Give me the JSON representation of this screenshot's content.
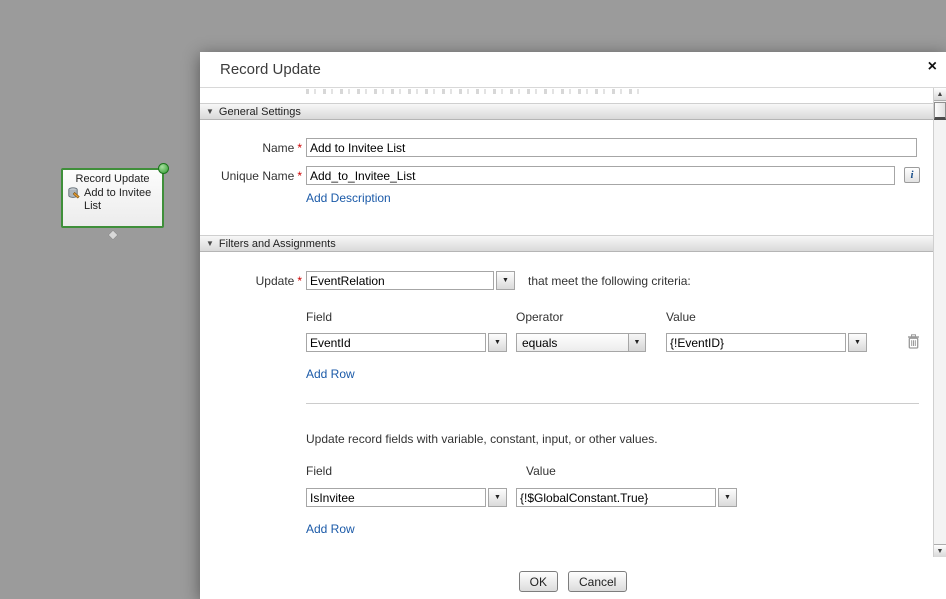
{
  "icons": {
    "collapse": "▼",
    "dropdown": "▼",
    "scroll_up": "▲",
    "scroll_down": "▼",
    "close": "×",
    "info": "i"
  },
  "canvas": {
    "node": {
      "title": "Record Update",
      "label": "Add to Invitee List"
    }
  },
  "dialog": {
    "title": "Record Update",
    "required_marker": "*",
    "general": {
      "header": "General Settings",
      "name_label": "Name",
      "name_value": "Add to Invitee List",
      "unique_name_label": "Unique Name",
      "unique_name_value": "Add_to_Invitee_List",
      "add_description": "Add Description"
    },
    "filters": {
      "header": "Filters and Assignments",
      "update_label": "Update",
      "update_value": "EventRelation",
      "criteria_text": "that meet the following criteria:",
      "col_field": "Field",
      "col_operator": "Operator",
      "col_value": "Value",
      "row": {
        "field": "EventId",
        "operator": "equals",
        "value": "{!EventID}"
      },
      "add_row": "Add Row"
    },
    "assignments": {
      "intro": "Update record fields with variable, constant, input, or other values.",
      "col_field": "Field",
      "col_value": "Value",
      "row": {
        "field": "IsInvitee",
        "value": "{!$GlobalConstant.True}"
      },
      "add_row": "Add Row"
    },
    "footer": {
      "ok": "OK",
      "cancel": "Cancel"
    }
  }
}
